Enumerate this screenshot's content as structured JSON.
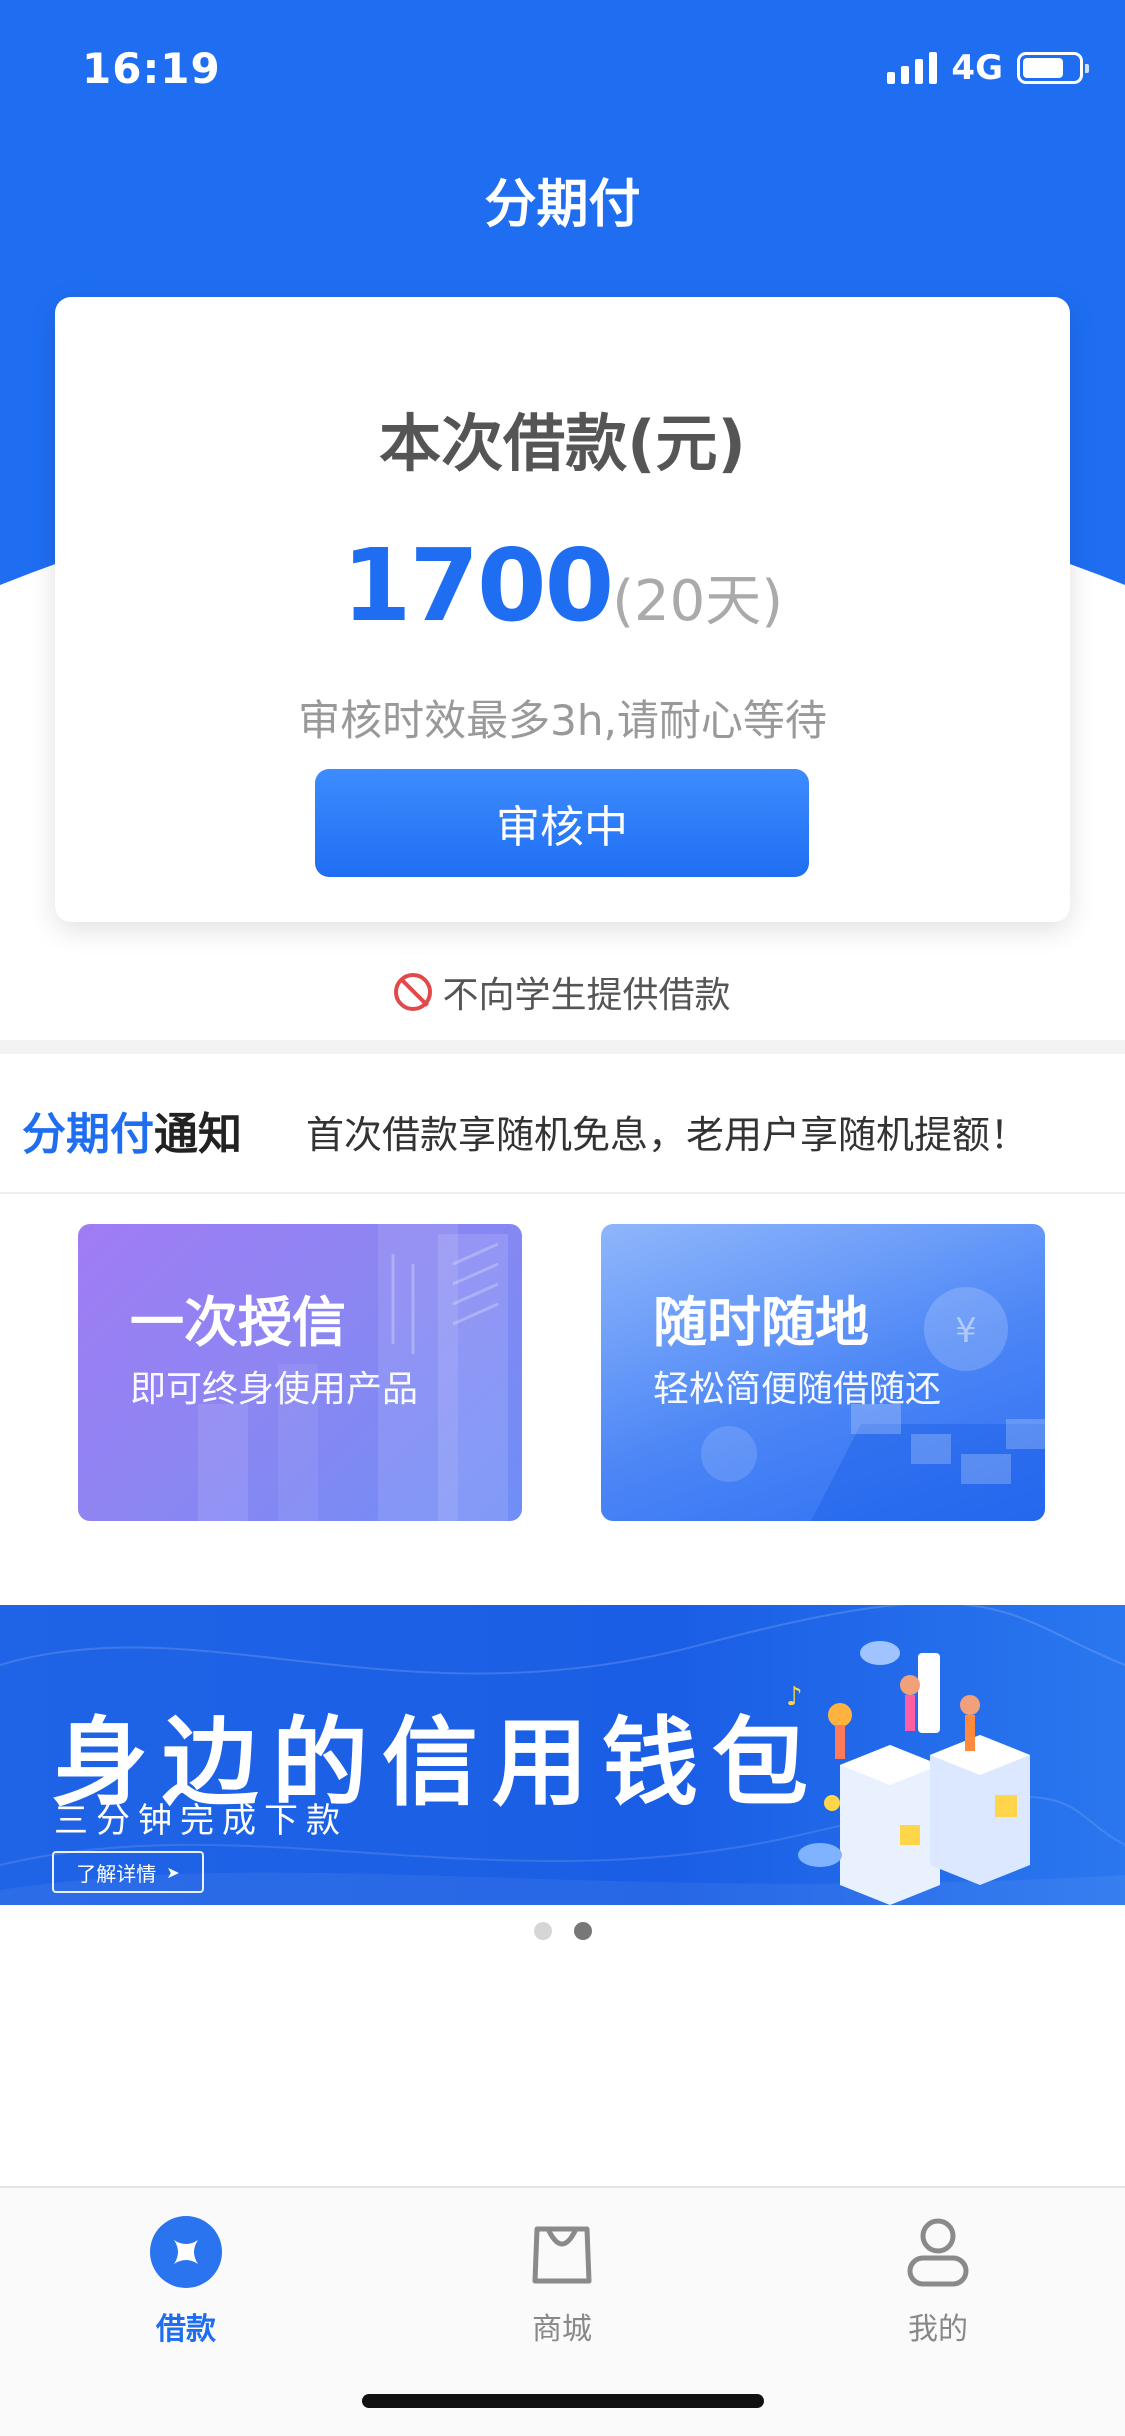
{
  "status_bar": {
    "time": "16:19",
    "network": "4G"
  },
  "header": {
    "title": "分期付"
  },
  "loan_card": {
    "label": "本次借款(元)",
    "amount": "1700",
    "period": "(20天)",
    "tip": "审核时效最多3h,请耐心等待",
    "button_label": "审核中"
  },
  "no_student_notice": "不向学生提供借款",
  "notice": {
    "brand_blue": "分期付",
    "brand_dark": "通知",
    "text": "首次借款享随机免息，老用户享随机提额！"
  },
  "features": [
    {
      "title": "一次授信",
      "subtitle": "即可终身使用产品"
    },
    {
      "title": "随时随地",
      "subtitle": "轻松简便随借随还"
    }
  ],
  "banner": {
    "title": "身边的信用钱包",
    "subtitle": "三分钟完成下款",
    "button_label": "了解详情",
    "button_arrow": "➤",
    "carousel_active_index": 1,
    "carousel_count": 2
  },
  "tabbar": {
    "items": [
      {
        "label": "借款",
        "icon": "loan-icon",
        "active": true
      },
      {
        "label": "商城",
        "icon": "shopping-bag-icon",
        "active": false
      },
      {
        "label": "我的",
        "icon": "profile-icon",
        "active": false
      }
    ]
  },
  "colors": {
    "primary": "#1f6ef2",
    "header_bg": "#1f6ef2",
    "forbid": "#e24a4a"
  }
}
